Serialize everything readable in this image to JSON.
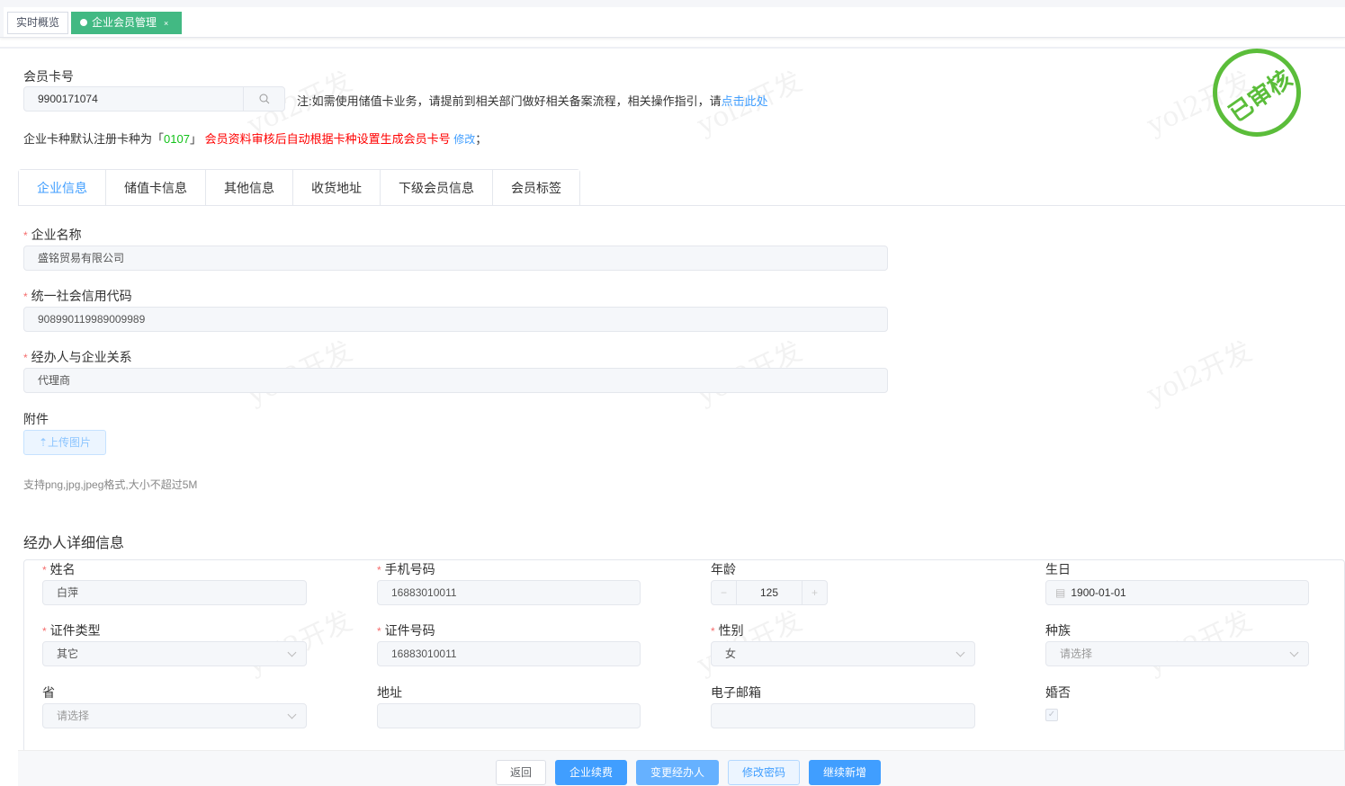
{
  "tabs_bar": {
    "tabs": [
      {
        "label": "实时概览"
      },
      {
        "label": "企业会员管理",
        "close": "×"
      }
    ]
  },
  "member_card": {
    "label": "会员卡号",
    "value": "9900171074",
    "note": "注:如需使用储值卡业务，请提前到相关部门做好相关备案流程，相关操作指引，请",
    "note_link": "点击此处"
  },
  "card_type": {
    "prefix": "企业卡种默认注册卡种为「",
    "code": "0107",
    "suffix": "」",
    "warning": "会员资料审核后自动根据卡种设置生成会员卡号",
    "edit_link": "修改",
    "end": "；"
  },
  "stamp": "已审核",
  "watermark": "yol2开发",
  "section_tabs": [
    "企业信息",
    "储值卡信息",
    "其他信息",
    "收货地址",
    "下级会员信息",
    "会员标签"
  ],
  "company": {
    "name_label": "企业名称",
    "name_value": "盛铭贸易有限公司",
    "code_label": "统一社会信用代码",
    "code_value": "908990119989009989",
    "relation_label": "经办人与企业关系",
    "relation_value": "代理商",
    "attach_label": "附件",
    "upload_label": "上传图片",
    "upload_hint": "支持png,jpg,jpeg格式,大小不超过5M"
  },
  "operator": {
    "title": "经办人详细信息",
    "name": {
      "label": "姓名",
      "value": "白萍"
    },
    "phone": {
      "label": "手机号码",
      "value": "16883010011"
    },
    "age": {
      "label": "年龄",
      "value": "125",
      "minus": "−",
      "plus": "+"
    },
    "birthday": {
      "label": "生日",
      "value": "1900-01-01"
    },
    "id_type": {
      "label": "证件类型",
      "value": "其它"
    },
    "id_no": {
      "label": "证件号码",
      "value": "16883010011"
    },
    "gender": {
      "label": "性别",
      "value": "女"
    },
    "ethnicity": {
      "label": "种族",
      "placeholder": "请选择"
    },
    "province": {
      "label": "省",
      "placeholder": "请选择"
    },
    "address": {
      "label": "地址",
      "value": ""
    },
    "email": {
      "label": "电子邮箱",
      "value": ""
    },
    "married": {
      "label": "婚否",
      "checked": true
    }
  },
  "footer": {
    "back": "返回",
    "renew": "企业续费",
    "change_operator": "变更经办人",
    "change_password": "修改密码",
    "continue_add": "继续新增"
  },
  "colors": {
    "primary": "#409eff",
    "green": "#42b983",
    "stamp": "#5bbd3a",
    "danger": "#f56c6c"
  }
}
